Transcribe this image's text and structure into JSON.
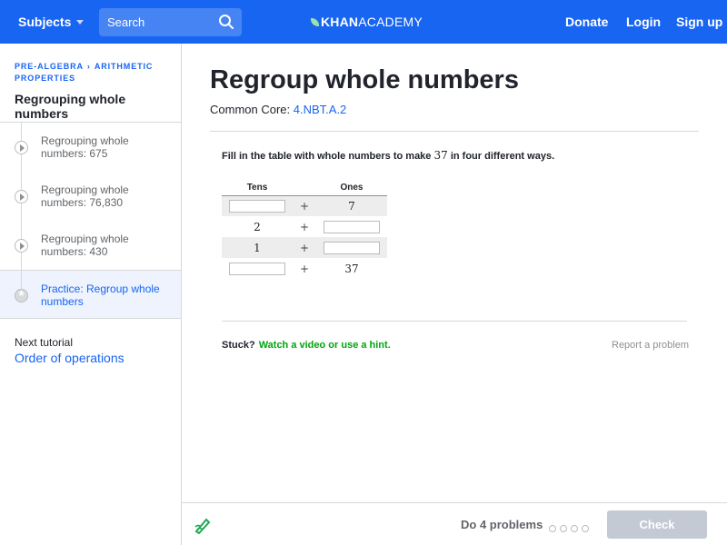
{
  "header": {
    "subjects_label": "Subjects",
    "search_placeholder": "Search",
    "logo_bold": "KHAN",
    "logo_light": "ACADEMY",
    "donate": "Donate",
    "login": "Login",
    "signup": "Sign up"
  },
  "sidebar": {
    "breadcrumb": [
      "PRE-ALGEBRA",
      "ARITHMETIC",
      "PROPERTIES"
    ],
    "title": "Regrouping whole numbers",
    "items": [
      {
        "label": "Regrouping whole numbers: 675",
        "type": "video"
      },
      {
        "label": "Regrouping whole numbers: 76,830",
        "type": "video"
      },
      {
        "label": "Regrouping whole numbers: 430",
        "type": "video"
      },
      {
        "label": "Practice: Regroup whole numbers",
        "type": "practice",
        "active": true
      }
    ],
    "next_label": "Next tutorial",
    "next_link": "Order of operations"
  },
  "main": {
    "title": "Regroup whole numbers",
    "common_core_label": "Common Core:",
    "common_core_link": "4.NBT.A.2",
    "prompt_before": "Fill in the table with whole numbers to make",
    "prompt_number": "37",
    "prompt_after": "in four different ways.",
    "table": {
      "headers": [
        "Tens",
        "Ones"
      ],
      "plus": "+",
      "rows": [
        {
          "tens": "",
          "ones": "7"
        },
        {
          "tens": "2",
          "ones": ""
        },
        {
          "tens": "1",
          "ones": ""
        },
        {
          "tens": "",
          "ones": "37"
        }
      ]
    },
    "stuck_label": "Stuck?",
    "hint_link": "Watch a video or use a hint.",
    "report_link": "Report a problem"
  },
  "footer": {
    "do_problems": "Do 4 problems",
    "progress_total": 4,
    "progress_done": 0,
    "check_label": "Check"
  },
  "colors": {
    "brand_blue": "#1865f2",
    "hint_green": "#00a60e",
    "check_disabled": "#c4cad3"
  }
}
